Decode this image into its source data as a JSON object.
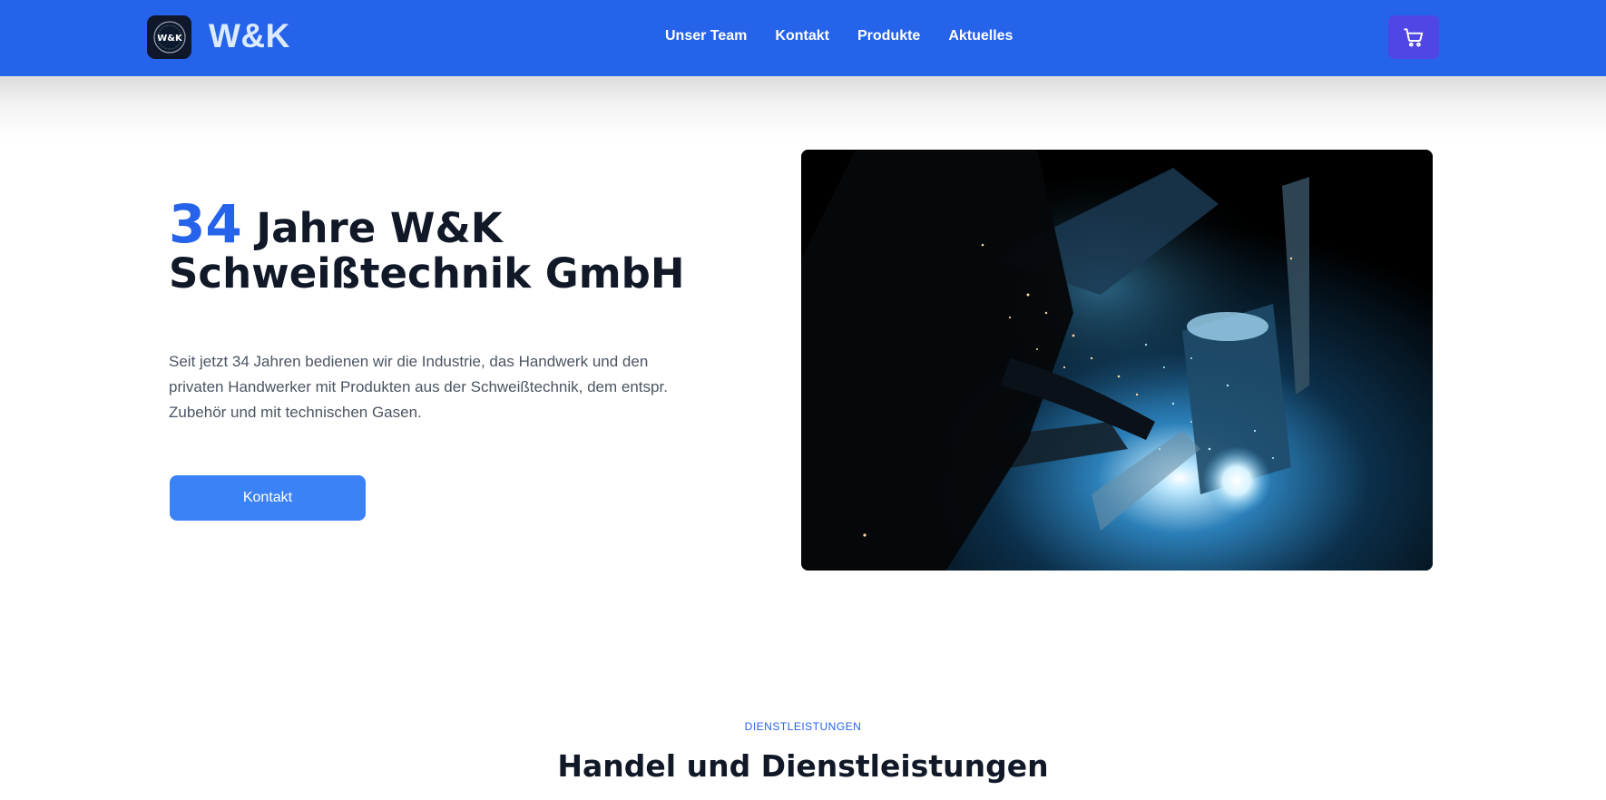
{
  "header": {
    "logo_text": "W&K",
    "brand": "W&K",
    "nav": [
      "Unser Team",
      "Kontakt",
      "Produkte",
      "Aktuelles"
    ],
    "cart_icon": "shopping-cart-icon",
    "colors": {
      "header_bg": "#2563eb",
      "cart_bg": "#4f46e5"
    }
  },
  "hero": {
    "title_number": "34",
    "title_line1": "Jahre W&K",
    "title_line2": "Schweißtechnik GmbH",
    "description": "Seit jetzt 34 Jahren bedienen wir die Industrie, das Handwerk und den privaten Handwerker mit Produkten aus der Schweißtechnik, dem entspr. Zubehör und mit technischen Gasen.",
    "cta_label": "Kontakt",
    "image": "welding-photo",
    "colors": {
      "accent": "#2563eb",
      "button": "#3b82f6"
    }
  },
  "services": {
    "eyebrow": "DIENSTLEISTUNGEN",
    "title": "Handel und Dienstleistungen"
  }
}
